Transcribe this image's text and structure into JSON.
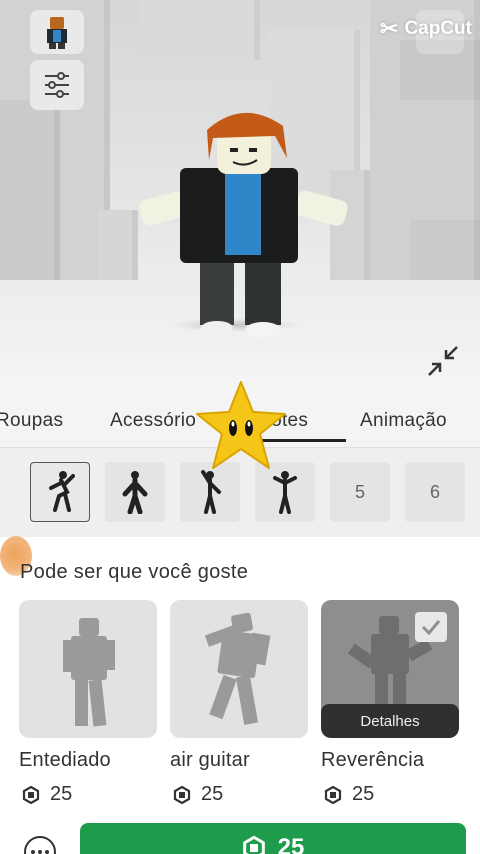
{
  "watermark": {
    "text": "CapCut"
  },
  "stage": {
    "avatar_thumb_icon": "avatar-thumbnail-icon",
    "filter_icon": "sliders-icon",
    "minimize_icon": "minimize-arrows-icon"
  },
  "tabs": [
    {
      "label": "Roupas",
      "active": false
    },
    {
      "label": "Acessório",
      "active": false
    },
    {
      "label": "Emotes",
      "active": true
    },
    {
      "label": "Animação",
      "active": false
    }
  ],
  "slots": [
    {
      "label": "",
      "icon": "emote-pose-1-icon",
      "selected": true
    },
    {
      "label": "",
      "icon": "emote-pose-2-icon",
      "selected": false
    },
    {
      "label": "",
      "icon": "emote-pose-3-icon",
      "selected": false
    },
    {
      "label": "",
      "icon": "emote-pose-4-icon",
      "selected": false
    },
    {
      "label": "5",
      "icon": "",
      "selected": false
    },
    {
      "label": "6",
      "icon": "",
      "selected": false
    }
  ],
  "suggestions": {
    "title": "Pode ser que você goste",
    "items": [
      {
        "name": "Entediado",
        "price": "25",
        "owned": false
      },
      {
        "name": "air guitar",
        "price": "25",
        "owned": false
      },
      {
        "name": "Reverência",
        "price": "25",
        "owned": true,
        "details_label": "Detalhes"
      }
    ]
  },
  "bottom_bar": {
    "more_icon": "more-options-icon",
    "buy_price": "25",
    "buy_color": "#1e9c4c"
  },
  "colors": {
    "accent_green": "#1e9c4c",
    "details_bg": "#303030",
    "star": "#f5c518"
  }
}
